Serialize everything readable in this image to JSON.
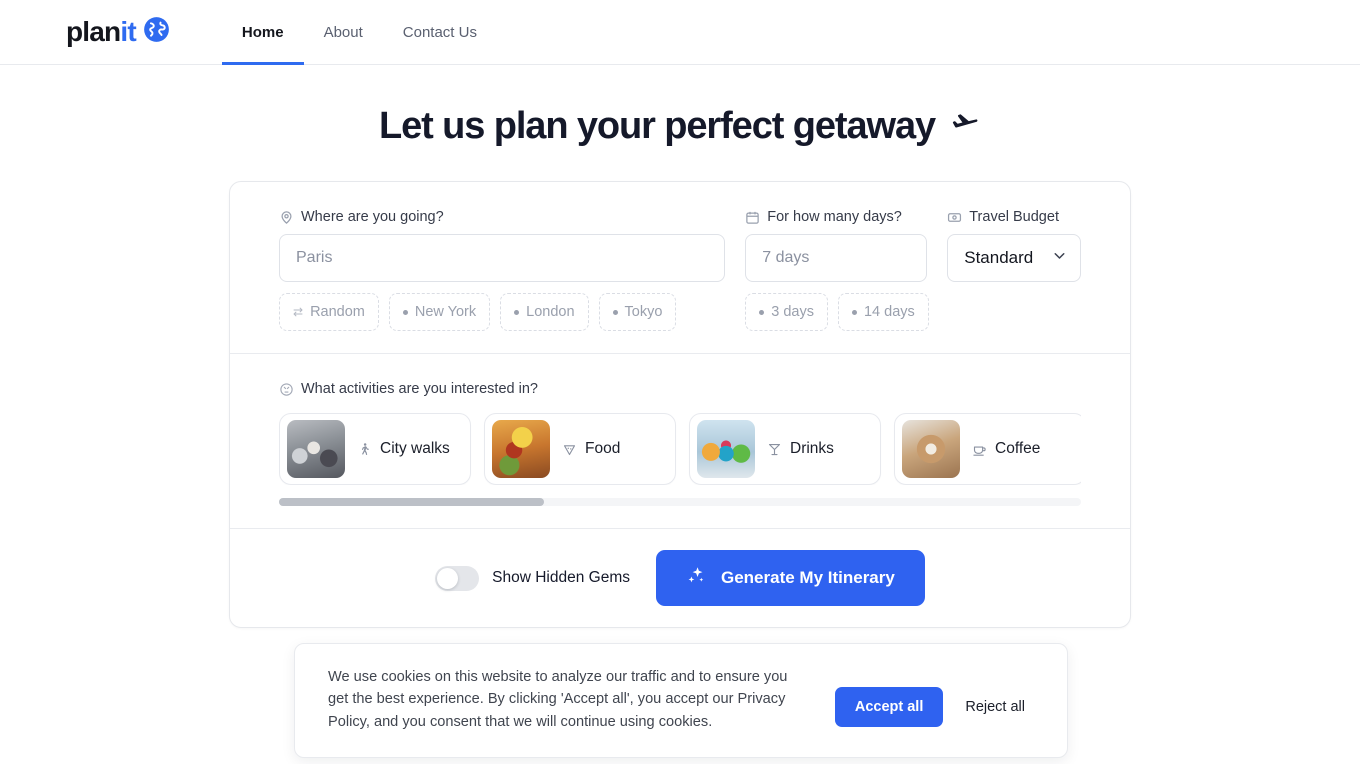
{
  "brand": {
    "name_part1": "plan",
    "name_part2": "it",
    "globe_icon": "globe-icon",
    "accent_color": "#2f6bf0"
  },
  "nav": {
    "links": [
      {
        "label": "Home",
        "active": true
      },
      {
        "label": "About",
        "active": false
      },
      {
        "label": "Contact Us",
        "active": false
      }
    ]
  },
  "hero": {
    "headline": "Let us plan your perfect getaway",
    "headline_icon": "airplane-icon"
  },
  "form": {
    "destination": {
      "icon": "location-pin-icon",
      "label": "Where are you going?",
      "value": "",
      "placeholder": "Paris",
      "chips": [
        {
          "label": "Random",
          "icon": "shuffle-icon"
        },
        {
          "label": "New York",
          "icon": "dot-icon"
        },
        {
          "label": "London",
          "icon": "dot-icon"
        },
        {
          "label": "Tokyo",
          "icon": "dot-icon"
        }
      ]
    },
    "days": {
      "icon": "calendar-icon",
      "label": "For how many days?",
      "value": "",
      "placeholder": "7 days",
      "chips": [
        {
          "label": "3 days",
          "icon": "dot-icon"
        },
        {
          "label": "14 days",
          "icon": "dot-icon"
        }
      ]
    },
    "budget": {
      "icon": "money-icon",
      "label": "Travel Budget",
      "selected": "Standard",
      "chevron_icon": "chevron-down-icon"
    }
  },
  "activities": {
    "icon": "activities-badge-icon",
    "label": "What activities are you interested in?",
    "items": [
      {
        "label": "City walks",
        "icon": "walking-person-icon",
        "thumb": "thumb-citywalks"
      },
      {
        "label": "Food",
        "icon": "pizza-slice-icon",
        "thumb": "thumb-food"
      },
      {
        "label": "Drinks",
        "icon": "cocktail-glass-icon",
        "thumb": "thumb-drinks"
      },
      {
        "label": "Coffee",
        "icon": "coffee-cup-icon",
        "thumb": "thumb-coffee"
      },
      {
        "label": "",
        "icon": "",
        "thumb": "thumb-partial"
      }
    ],
    "scroll_position_percent": 0,
    "scroll_thumb_width_percent": 33
  },
  "action_bar": {
    "toggle": {
      "label": "Show Hidden Gems",
      "state": "off"
    },
    "generate_button": {
      "label": "Generate My Itinerary",
      "icon": "sparkles-icon"
    }
  },
  "cookie_banner": {
    "message": "We use cookies on this website to analyze our traffic and to ensure you get the best experience. By clicking 'Accept all', you accept our Privacy Policy, and you consent that we will continue using cookies.",
    "accept_label": "Accept all",
    "reject_label": "Reject all"
  }
}
